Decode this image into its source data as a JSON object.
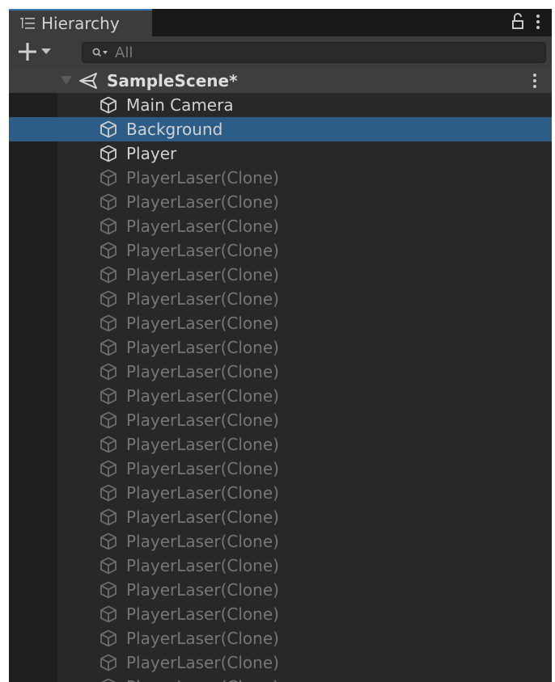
{
  "tab": {
    "title": "Hierarchy"
  },
  "toolbar": {
    "search_placeholder": "All"
  },
  "scene": {
    "name": "SampleScene*"
  },
  "items": [
    {
      "label": "Main Camera",
      "state": "normal"
    },
    {
      "label": "Background",
      "state": "selected"
    },
    {
      "label": "Player",
      "state": "normal"
    },
    {
      "label": "PlayerLaser(Clone)",
      "state": "inactive"
    },
    {
      "label": "PlayerLaser(Clone)",
      "state": "inactive"
    },
    {
      "label": "PlayerLaser(Clone)",
      "state": "inactive"
    },
    {
      "label": "PlayerLaser(Clone)",
      "state": "inactive"
    },
    {
      "label": "PlayerLaser(Clone)",
      "state": "inactive"
    },
    {
      "label": "PlayerLaser(Clone)",
      "state": "inactive"
    },
    {
      "label": "PlayerLaser(Clone)",
      "state": "inactive"
    },
    {
      "label": "PlayerLaser(Clone)",
      "state": "inactive"
    },
    {
      "label": "PlayerLaser(Clone)",
      "state": "inactive"
    },
    {
      "label": "PlayerLaser(Clone)",
      "state": "inactive"
    },
    {
      "label": "PlayerLaser(Clone)",
      "state": "inactive"
    },
    {
      "label": "PlayerLaser(Clone)",
      "state": "inactive"
    },
    {
      "label": "PlayerLaser(Clone)",
      "state": "inactive"
    },
    {
      "label": "PlayerLaser(Clone)",
      "state": "inactive"
    },
    {
      "label": "PlayerLaser(Clone)",
      "state": "inactive"
    },
    {
      "label": "PlayerLaser(Clone)",
      "state": "inactive"
    },
    {
      "label": "PlayerLaser(Clone)",
      "state": "inactive"
    },
    {
      "label": "PlayerLaser(Clone)",
      "state": "inactive"
    },
    {
      "label": "PlayerLaser(Clone)",
      "state": "inactive"
    },
    {
      "label": "PlayerLaser(Clone)",
      "state": "inactive"
    },
    {
      "label": "PlayerLaser(Clone)",
      "state": "inactive"
    },
    {
      "label": "PlayerLaser(Clone)",
      "state": "inactive"
    }
  ],
  "icons": {
    "tab": "hierarchy-list-icon",
    "lock": "lock-icon",
    "menu": "kebab-menu-icon",
    "add": "plus-icon",
    "dropdown": "caret-down-icon",
    "search": "search-icon",
    "scene": "unity-scene-icon",
    "gameobject": "cube-icon"
  },
  "colors": {
    "panel": "#282828",
    "tab_active": "#3c3c3c",
    "tab_accent": "#3a79bb",
    "selection": "#2c5d87",
    "text": "#d2d2d2",
    "text_inactive": "#767676"
  }
}
